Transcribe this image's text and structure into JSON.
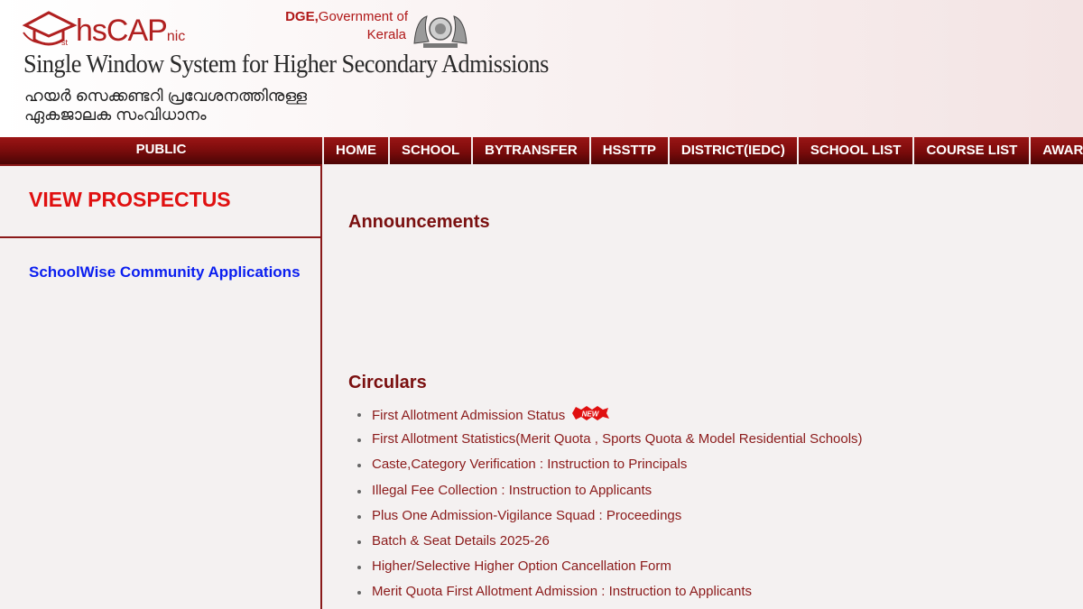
{
  "header": {
    "logo_main": "hsCAP",
    "logo_suffix": "nic",
    "dge_label": "DGE,",
    "govt_line": "Government of",
    "state": "Kerala",
    "title": "Single Window System for Higher Secondary Admissions",
    "malayalam_line1": "ഹയർ സെക്കണ്ടറി പ്രവേശനത്തിനുള്ള",
    "malayalam_line2": "ഏകജാലക സംവിധാനം"
  },
  "nav": {
    "section_label": "PUBLIC",
    "items": [
      "HOME",
      "SCHOOL",
      "BYTRANSFER",
      "HSSTTP",
      "DISTRICT(IEDC)",
      "SCHOOL LIST",
      "COURSE LIST",
      "AWARDS"
    ]
  },
  "sidebar": {
    "prospectus_link": "VIEW PROSPECTUS",
    "community_link": "SchoolWise Community Applications"
  },
  "main": {
    "announcements_heading": "Announcements",
    "circulars_heading": "Circulars",
    "new_badge": "NEW",
    "circulars": [
      "First Allotment Admission Status",
      "First Allotment Statistics(Merit Quota , Sports Quota & Model Residential Schools)",
      "Caste,Category Verification : Instruction to Principals",
      "Illegal Fee Collection : Instruction to Applicants",
      "Plus One Admission-Vigilance Squad : Proceedings",
      "Batch & Seat Details 2025-26",
      "Higher/Selective Higher Option Cancellation Form",
      "Merit Quota First Allotment Admission : Instruction to Applicants"
    ]
  },
  "colors": {
    "brand_red": "#b02020",
    "nav_dark": "#7a0c0c",
    "link_red": "#e01010",
    "link_blue": "#0a1ef0",
    "circular_text": "#8b1a1a"
  }
}
